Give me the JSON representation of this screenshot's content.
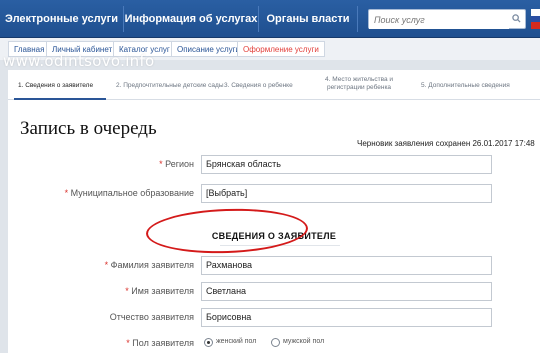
{
  "nav": {
    "items": [
      "Электронные услуги",
      "Информация об услугах",
      "Органы власти"
    ],
    "search_placeholder": "Поиск услуг",
    "flag_colors": [
      "#ffffff",
      "#2b4fa3",
      "#d52b1e"
    ]
  },
  "breadcrumbs": [
    "Главная",
    "Личный кабинет",
    "Каталог услуг",
    "Описание услуги",
    "Оформление услуги"
  ],
  "watermark": "www.odintsovo.info",
  "steps": [
    "1. Сведения о заявителе",
    "2. Предпочтительные детские сады",
    "3. Сведения о ребенке",
    "4. Место жительства и регистрации ребенка",
    "5. Дополнительные сведения"
  ],
  "title": "Запись в очередь",
  "draft_status": "Черновик заявления сохранен 26.01.2017 17:48",
  "required_mark": "*",
  "form": {
    "region_label": "Регион",
    "region_value": "Брянская область",
    "municipality_label": "Муниципальное образование",
    "municipality_value": "[Выбрать]",
    "section_title": "СВЕДЕНИЯ О ЗАЯВИТЕЛЕ",
    "surname_label": "Фамилия заявителя",
    "surname_value": "Рахманова",
    "name_label": "Имя заявителя",
    "name_value": "Светлана",
    "patronymic_label": "Отчество заявителя",
    "patronymic_value": "Борисовна",
    "gender_label": "Пол заявителя",
    "gender_options": [
      "женский пол",
      "мужской пол"
    ],
    "gender_selected": "женский пол"
  },
  "colors": {
    "nav_bg": "#1f4f8f",
    "link": "#2a5597",
    "active_crumb": "#e2403b",
    "required": "#d9302a",
    "highlight": "#d41a1a"
  }
}
